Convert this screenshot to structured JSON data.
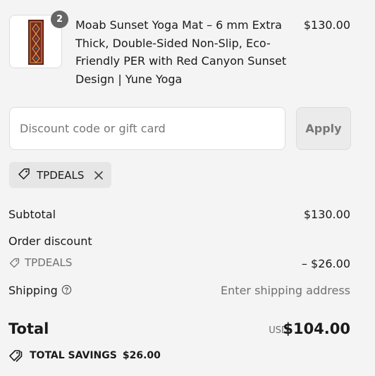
{
  "product": {
    "quantity_badge": "2",
    "title": "Moab Sunset Yoga Mat – 6 mm Extra Thick, Double-Sided Non-Slip, Eco-Friendly PER with Red Canyon Sunset Design | Yune Yoga",
    "price": "$130.00"
  },
  "discount": {
    "placeholder": "Discount code or gift card",
    "apply_label": "Apply",
    "applied_code": "TPDEALS"
  },
  "summary": {
    "subtotal_label": "Subtotal",
    "subtotal_value": "$130.00",
    "order_discount_label": "Order discount",
    "discount_code": "TPDEALS",
    "discount_value": "– $26.00",
    "shipping_label": "Shipping",
    "shipping_value": "Enter shipping address",
    "total_label": "Total",
    "total_currency": "USD",
    "total_value": "$104.00",
    "savings_label": "TOTAL SAVINGS",
    "savings_value": "$26.00"
  },
  "icons": {
    "tag": "tag-icon",
    "close": "close-icon",
    "help": "help-circle-icon",
    "tags": "tags-icon"
  },
  "colors": {
    "background": "#f4f4f4",
    "muted_text": "#707070",
    "badge": "#666666"
  }
}
